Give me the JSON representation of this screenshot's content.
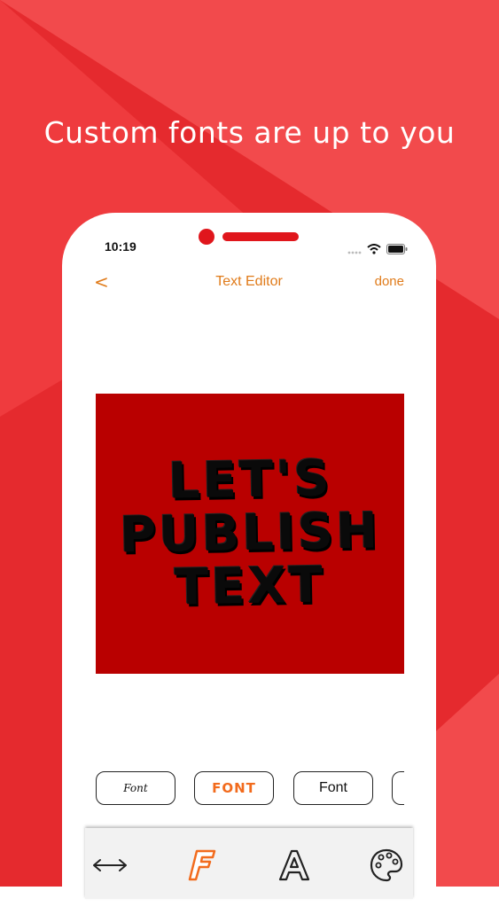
{
  "headline": "Custom fonts are up to you",
  "status_bar": {
    "time": "10:19"
  },
  "nav": {
    "back_label": "<",
    "title": "Text Editor",
    "done_label": "done"
  },
  "canvas": {
    "background_color": "#b90000",
    "lines": [
      "LET'S",
      "PUBLISH",
      "TEXT"
    ]
  },
  "font_options": [
    {
      "label": "Font",
      "style": "script"
    },
    {
      "label": "FONT",
      "style": "bold-orange",
      "selected": true
    },
    {
      "label": "Font",
      "style": "regular"
    }
  ],
  "toolbar": {
    "tools": [
      {
        "icon": "resize-arrows-icon"
      },
      {
        "icon": "font-f-icon",
        "active": true
      },
      {
        "icon": "letter-a-icon"
      },
      {
        "icon": "palette-icon"
      }
    ]
  },
  "colors": {
    "accent": "#e07b1a",
    "brand_red": "#e0161c",
    "active_tool": "#f26b1d"
  }
}
